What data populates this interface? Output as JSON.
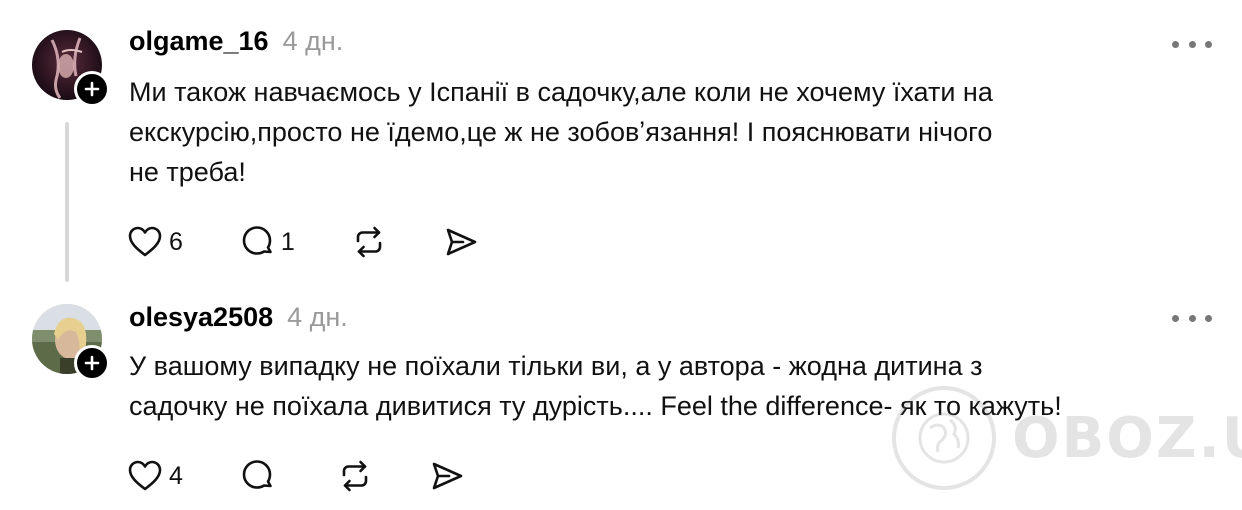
{
  "comments": [
    {
      "username": "olgame_16",
      "time": "4 дн.",
      "text_lines": [
        "Ми також навчаємось у Іспанії в садочку,але коли не хочему їхати на",
        "екскурсію,просто не їдемо,це ж не зобовʼязання! І пояснювати нічого",
        "не треба!"
      ],
      "likes": "6",
      "replies": "1",
      "icons": [
        "heart-icon",
        "comment-icon",
        "repost-icon",
        "share-icon"
      ]
    },
    {
      "username": "olesya2508",
      "time": "4 дн.",
      "text_lines": [
        "У вашому випадку не поїхали тільки ви, а у автора - жодна дитина з",
        "садочку не поїхала дивитися ту дурість.... Feel the difference- як то кажуть!"
      ],
      "likes": "4",
      "replies": "",
      "icons": [
        "heart-icon",
        "comment-icon",
        "repost-icon",
        "share-icon"
      ]
    }
  ],
  "watermark": {
    "text": "OBOZ.UA",
    "icon": "globe-icon"
  }
}
